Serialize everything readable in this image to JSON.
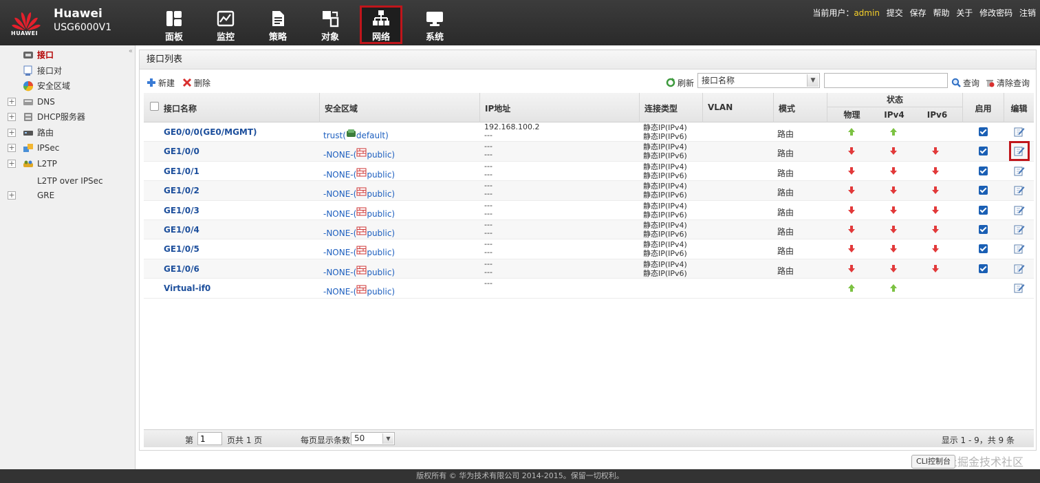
{
  "header": {
    "logo_text": "HUAWEI",
    "brand": "Huawei",
    "model": "USG6000V1",
    "nav": [
      {
        "label": "面板",
        "icon": "dashboard-icon"
      },
      {
        "label": "监控",
        "icon": "monitor-chart-icon"
      },
      {
        "label": "策略",
        "icon": "policy-document-icon"
      },
      {
        "label": "对象",
        "icon": "object-icon"
      },
      {
        "label": "网络",
        "icon": "network-topology-icon",
        "active": true
      },
      {
        "label": "系统",
        "icon": "system-monitor-icon"
      }
    ],
    "user_prefix": "当前用户：",
    "user_name": "admin",
    "links": [
      "提交",
      "保存",
      "帮助",
      "关于",
      "修改密码",
      "注销"
    ]
  },
  "sidebar": {
    "collapse_glyph": "«",
    "items": [
      {
        "label": "接口",
        "icon": "interface-icon",
        "expandable": false,
        "active": true
      },
      {
        "label": "接口对",
        "icon": "interface-pair-icon",
        "expandable": false
      },
      {
        "label": "安全区域",
        "icon": "security-zone-icon",
        "expandable": false
      },
      {
        "label": "DNS",
        "icon": "dns-icon",
        "expandable": true
      },
      {
        "label": "DHCP服务器",
        "icon": "dhcp-server-icon",
        "expandable": true
      },
      {
        "label": "路由",
        "icon": "route-icon",
        "expandable": true
      },
      {
        "label": "IPSec",
        "icon": "ipsec-icon",
        "expandable": true
      },
      {
        "label": "L2TP",
        "icon": "l2tp-icon",
        "expandable": true
      },
      {
        "label": "L2TP over IPSec",
        "icon": "",
        "expandable": false
      },
      {
        "label": "GRE",
        "icon": "",
        "expandable": true
      }
    ]
  },
  "panel": {
    "title": "接口列表",
    "toolbar": {
      "new_label": "新建",
      "delete_label": "删除",
      "refresh_label": "刷新",
      "search_field": "接口名称",
      "search_value": "",
      "query_label": "查询",
      "clear_label": "清除查询"
    },
    "columns": {
      "name": "接口名称",
      "zone": "安全区域",
      "ip": "IP地址",
      "conn": "连接类型",
      "vlan": "VLAN",
      "mode": "模式",
      "state": "状态",
      "phys": "物理",
      "ipv4": "IPv4",
      "ipv6": "IPv6",
      "enable": "启用",
      "edit": "编辑"
    },
    "rows": [
      {
        "name": "GE0/0/0(GE0/MGMT)",
        "zone_prefix": "trust(",
        "zone_name": "default)",
        "zone_icon": "green",
        "ip": "192.168.100.2\n---",
        "conn": "静态IP(IPv4)\n静态IP(IPv6)",
        "mode": "路由",
        "phys": "up",
        "ipv4": "up",
        "ipv6": "",
        "enabled": true
      },
      {
        "name": "GE1/0/0",
        "zone_prefix": "-NONE-(",
        "zone_name": "public)",
        "zone_icon": "red",
        "ip": "---\n---",
        "conn": "静态IP(IPv4)\n静态IP(IPv6)",
        "mode": "路由",
        "phys": "down",
        "ipv4": "down",
        "ipv6": "down",
        "enabled": true,
        "highlight_edit": true
      },
      {
        "name": "GE1/0/1",
        "zone_prefix": "-NONE-(",
        "zone_name": "public)",
        "zone_icon": "red",
        "ip": "---\n---",
        "conn": "静态IP(IPv4)\n静态IP(IPv6)",
        "mode": "路由",
        "phys": "down",
        "ipv4": "down",
        "ipv6": "down",
        "enabled": true
      },
      {
        "name": "GE1/0/2",
        "zone_prefix": "-NONE-(",
        "zone_name": "public)",
        "zone_icon": "red",
        "ip": "---\n---",
        "conn": "静态IP(IPv4)\n静态IP(IPv6)",
        "mode": "路由",
        "phys": "down",
        "ipv4": "down",
        "ipv6": "down",
        "enabled": true
      },
      {
        "name": "GE1/0/3",
        "zone_prefix": "-NONE-(",
        "zone_name": "public)",
        "zone_icon": "red",
        "ip": "---\n---",
        "conn": "静态IP(IPv4)\n静态IP(IPv6)",
        "mode": "路由",
        "phys": "down",
        "ipv4": "down",
        "ipv6": "down",
        "enabled": true
      },
      {
        "name": "GE1/0/4",
        "zone_prefix": "-NONE-(",
        "zone_name": "public)",
        "zone_icon": "red",
        "ip": "---\n---",
        "conn": "静态IP(IPv4)\n静态IP(IPv6)",
        "mode": "路由",
        "phys": "down",
        "ipv4": "down",
        "ipv6": "down",
        "enabled": true
      },
      {
        "name": "GE1/0/5",
        "zone_prefix": "-NONE-(",
        "zone_name": "public)",
        "zone_icon": "red",
        "ip": "---\n---",
        "conn": "静态IP(IPv4)\n静态IP(IPv6)",
        "mode": "路由",
        "phys": "down",
        "ipv4": "down",
        "ipv6": "down",
        "enabled": true
      },
      {
        "name": "GE1/0/6",
        "zone_prefix": "-NONE-(",
        "zone_name": "public)",
        "zone_icon": "red",
        "ip": "---\n---",
        "conn": "静态IP(IPv4)\n静态IP(IPv6)",
        "mode": "路由",
        "phys": "down",
        "ipv4": "down",
        "ipv6": "down",
        "enabled": true
      },
      {
        "name": "Virtual-if0",
        "zone_prefix": "-NONE-(",
        "zone_name": "public)",
        "zone_icon": "red",
        "ip": "---",
        "conn": "",
        "mode": "",
        "phys": "up",
        "ipv4": "up",
        "ipv6": "",
        "enabled": false
      }
    ],
    "pager": {
      "page_prefix": "第",
      "page_value": "1",
      "page_suffix": "页共 1 页",
      "per_page_label": "每页显示条数",
      "per_page_value": "50",
      "summary": "显示 1 - 9，共 9 条"
    }
  },
  "footer": {
    "copyright": "版权所有 © 华为技术有限公司 2014-2015。保留一切权利。",
    "cli_button": "CLI控制台",
    "watermark": "@稀土掘金技术社区"
  },
  "colors": {
    "header_bg": "#2f2f2f",
    "active_nav_border": "#c0151b",
    "user_name": "#f6d02a",
    "link_blue": "#1d4f9c",
    "status_up": "#7cc242",
    "status_down": "#e2393a"
  }
}
